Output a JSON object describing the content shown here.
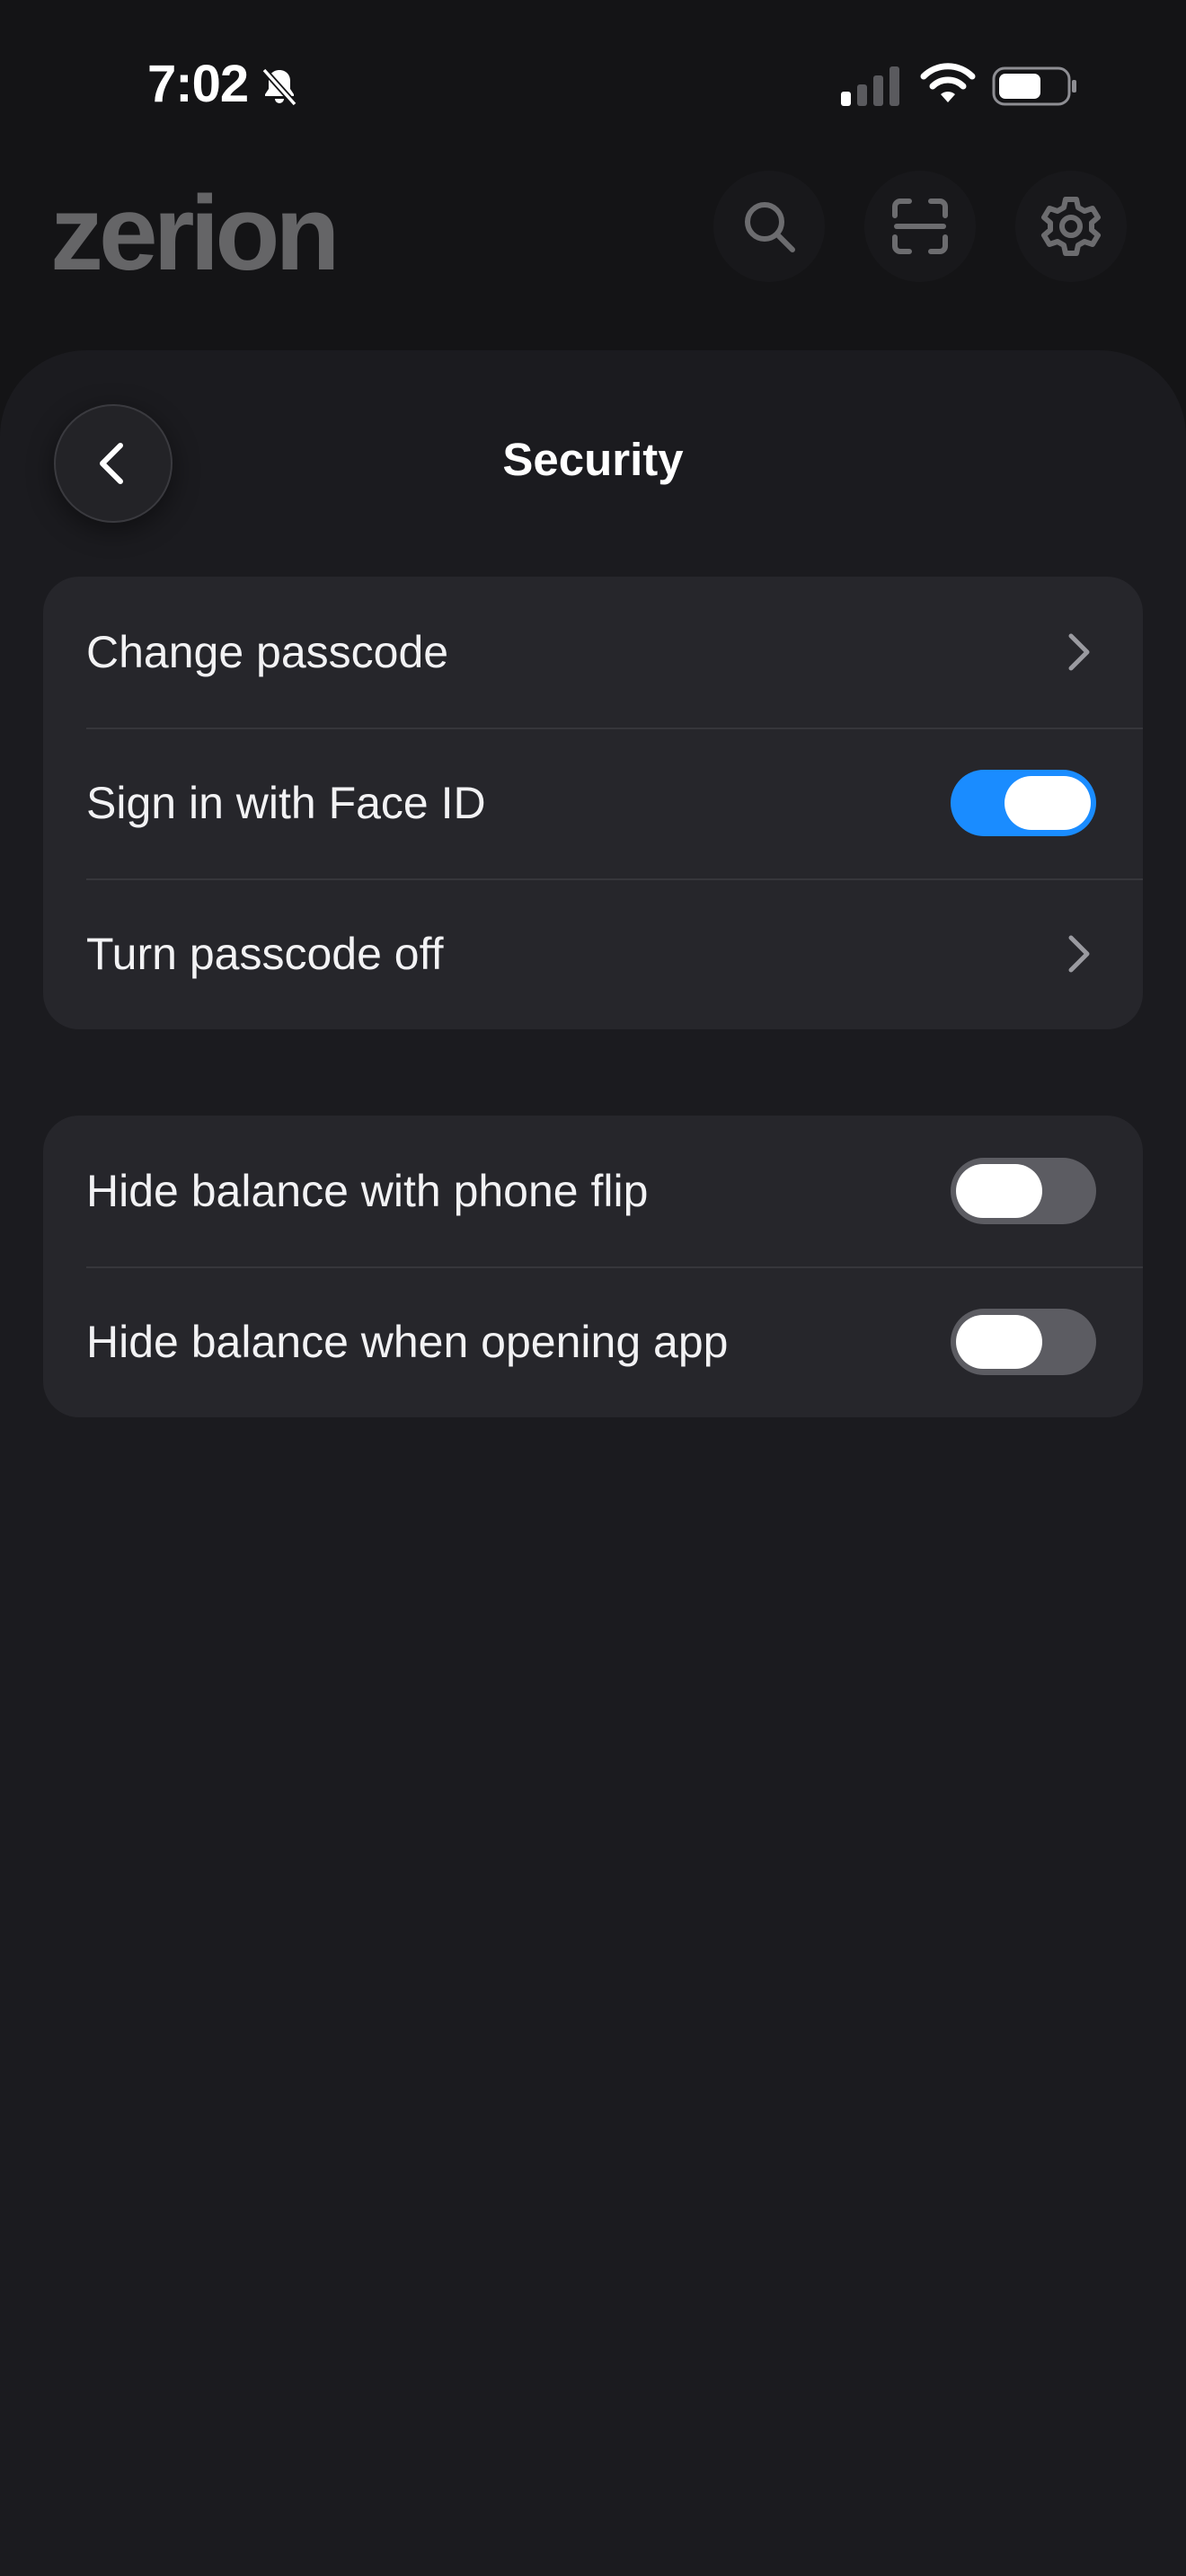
{
  "status_bar": {
    "time": "7:02",
    "icons": [
      "bell-slash-icon",
      "signal-icon",
      "wifi-icon",
      "battery-icon"
    ]
  },
  "header": {
    "logo": "zerion",
    "buttons": [
      "search-icon",
      "scan-icon",
      "gear-icon"
    ]
  },
  "sheet": {
    "title": "Security",
    "back_icon": "chevron-left-icon"
  },
  "groups": [
    {
      "rows": [
        {
          "label": "Change passcode",
          "control": "chevron"
        },
        {
          "label": "Sign in with Face ID",
          "control": "toggle",
          "on": true
        },
        {
          "label": "Turn passcode off",
          "control": "chevron"
        }
      ]
    },
    {
      "rows": [
        {
          "label": "Hide balance with phone flip",
          "control": "toggle",
          "on": false
        },
        {
          "label": "Hide balance when opening app",
          "control": "toggle",
          "on": false
        }
      ]
    }
  ],
  "colors": {
    "background": "#141416",
    "sheet": "#1b1b1f",
    "group": "#26262b",
    "toggle_on": "#1a8cff",
    "toggle_off": "#5c5c62"
  }
}
